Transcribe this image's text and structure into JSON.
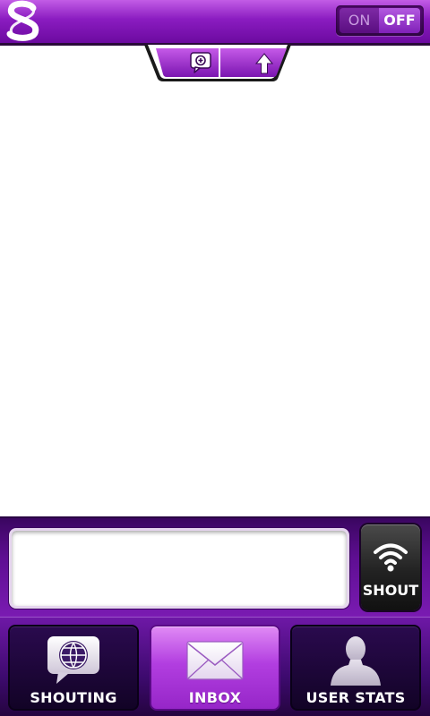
{
  "app": {
    "logo_icon": "s-logo-icon",
    "accent_color": "#8a1cc0"
  },
  "status_toggle": {
    "on_label": "ON",
    "off_label": "OFF",
    "selected": "OFF"
  },
  "top_tabs": {
    "compose_icon": "speech-bubble-plus-icon",
    "upload_icon": "up-arrow-icon"
  },
  "composer": {
    "input_value": "",
    "shout_label": "SHOUT",
    "shout_icon": "wifi-signal-icon"
  },
  "bottom_nav": {
    "items": [
      {
        "label": "SHOUTING",
        "icon": "globe-speech-bubble-icon",
        "active": false
      },
      {
        "label": "INBOX",
        "icon": "envelope-icon",
        "active": true
      },
      {
        "label": "USER STATS",
        "icon": "user-silhouette-icon",
        "active": false
      }
    ]
  }
}
